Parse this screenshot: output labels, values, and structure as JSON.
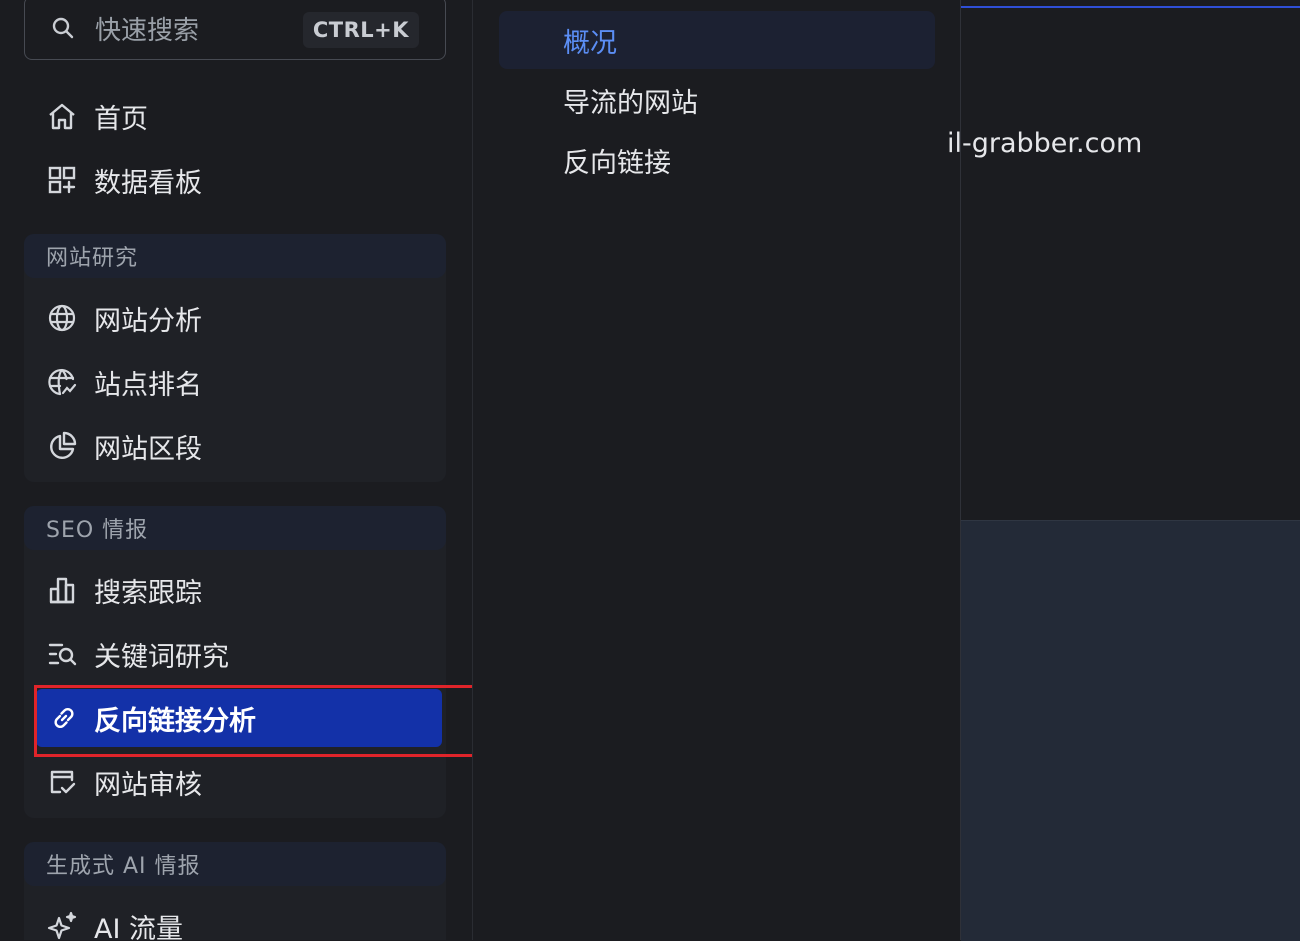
{
  "search": {
    "placeholder": "快速搜索",
    "shortcut": "CTRL+K"
  },
  "nav": {
    "top_items": [
      {
        "label": "首页",
        "icon": "home-icon"
      },
      {
        "label": "数据看板",
        "icon": "dashboard-icon"
      }
    ],
    "groups": [
      {
        "title": "网站研究",
        "items": [
          {
            "label": "网站分析",
            "icon": "globe-icon"
          },
          {
            "label": "站点排名",
            "icon": "globe-ranking-icon"
          },
          {
            "label": "网站区段",
            "icon": "pie-chart-icon"
          }
        ]
      },
      {
        "title": "SEO 情报",
        "items": [
          {
            "label": "搜索跟踪",
            "icon": "bar-chart-icon"
          },
          {
            "label": "关键词研究",
            "icon": "keyword-search-icon"
          },
          {
            "label": "反向链接分析",
            "icon": "link-icon",
            "active": true
          },
          {
            "label": "网站审核",
            "icon": "audit-icon"
          }
        ]
      },
      {
        "title": "生成式 AI 情报",
        "items": [
          {
            "label": "AI 流量",
            "icon": "sparkle-icon"
          }
        ]
      }
    ]
  },
  "submenu": {
    "items": [
      {
        "label": "概况",
        "selected": true
      },
      {
        "label": "导流的网站"
      },
      {
        "label": "反向链接"
      }
    ]
  },
  "content": {
    "domain_text": "il-grabber.com"
  },
  "colors": {
    "background": "#1b1c20",
    "active_item": "#1331a8",
    "selected_text": "#5b8ef5",
    "highlight_border": "#e0242a"
  }
}
